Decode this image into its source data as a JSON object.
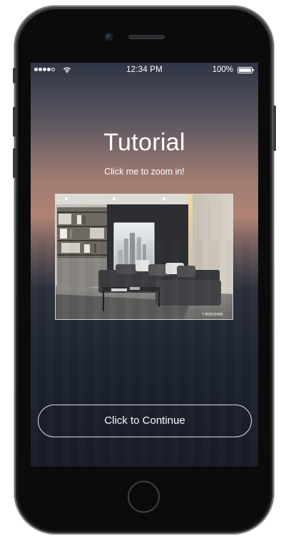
{
  "status_bar": {
    "signal_bars_filled": 4,
    "signal_bars_total": 5,
    "wifi_icon": "wifi-icon",
    "time": "12:34 PM",
    "battery_percent": "100%",
    "battery_icon": "battery-full-icon"
  },
  "tutorial": {
    "title": "Tutorial",
    "subtitle": "Click me to zoom in!",
    "image_alt": "Living room interior photo",
    "image_watermark": "Y·BORZHEN"
  },
  "actions": {
    "continue_label": "Click to Continue"
  },
  "colors": {
    "screen_top": "#2f3545",
    "screen_glow": "#b08274",
    "screen_bottom": "#181d28",
    "button_outline": "#ffffff",
    "phone_body": "#1a1a1b"
  }
}
